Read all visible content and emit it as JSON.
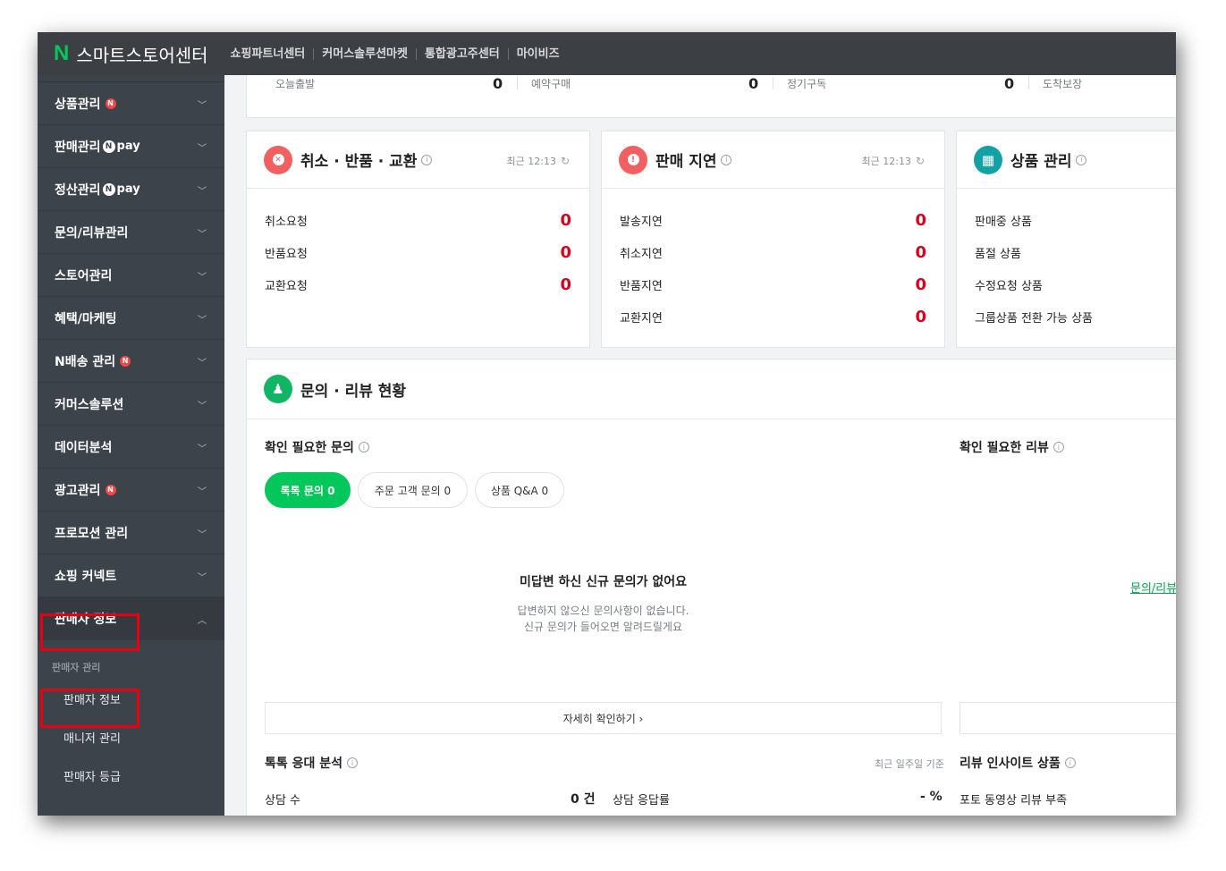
{
  "topbar": {
    "logo": "N",
    "title": "스마트스토어센터",
    "links": [
      "쇼핑파트너센터",
      "커머스솔루션마켓",
      "통합광고주센터",
      "마이비즈"
    ]
  },
  "sidebar": {
    "items": [
      {
        "label": "상품관리",
        "badge": "N",
        "pay": ""
      },
      {
        "label": "판매관리",
        "badge": "",
        "pay": "pay"
      },
      {
        "label": "정산관리",
        "badge": "",
        "pay": "pay"
      },
      {
        "label": "문의/리뷰관리",
        "badge": "",
        "pay": ""
      },
      {
        "label": "스토어관리",
        "badge": "",
        "pay": ""
      },
      {
        "label": "혜택/마케팅",
        "badge": "",
        "pay": ""
      },
      {
        "label": "N배송 관리",
        "badge": "N",
        "pay": ""
      },
      {
        "label": "커머스솔루션",
        "badge": "",
        "pay": ""
      },
      {
        "label": "데이터분석",
        "badge": "",
        "pay": ""
      },
      {
        "label": "광고관리",
        "badge": "N",
        "pay": ""
      },
      {
        "label": "프로모션 관리",
        "badge": "",
        "pay": ""
      },
      {
        "label": "쇼핑 커넥트",
        "badge": "",
        "pay": ""
      },
      {
        "label": "판매자 정보",
        "badge": "",
        "pay": ""
      }
    ],
    "npay_letter": "N",
    "sub_heading": "판매자 관리",
    "sub_items": [
      "판매자 정보",
      "매니저 관리",
      "판매자 등급"
    ]
  },
  "stats": {
    "cells": [
      {
        "label": "오늘출발",
        "value": "0"
      },
      {
        "label": "예약구매",
        "value": "0"
      },
      {
        "label": "정기구독",
        "value": "0"
      },
      {
        "label": "도착보장",
        "value": ""
      }
    ]
  },
  "cancel_card": {
    "title": "취소 · 반품 · 교환",
    "updated": "최근 12:13",
    "rows": [
      {
        "label": "취소요청",
        "value": "0"
      },
      {
        "label": "반품요청",
        "value": "0"
      },
      {
        "label": "교환요청",
        "value": "0"
      }
    ]
  },
  "delay_card": {
    "title": "판매 지연",
    "updated": "최근 12:13",
    "rows": [
      {
        "label": "발송지연",
        "value": "0"
      },
      {
        "label": "취소지연",
        "value": "0"
      },
      {
        "label": "반품지연",
        "value": "0"
      },
      {
        "label": "교환지연",
        "value": "0"
      }
    ]
  },
  "product_card": {
    "title": "상품 관리",
    "rows": [
      {
        "label": "판매중 상품"
      },
      {
        "label": "품절 상품"
      },
      {
        "label": "수정요청 상품"
      },
      {
        "label": "그룹상품 전환 가능 상품"
      }
    ]
  },
  "inquiry_card": {
    "title": "문의 · 리뷰 현황",
    "inquiry_section_title": "확인 필요한 문의",
    "review_section_title": "확인 필요한 리뷰",
    "pills": [
      {
        "label": "톡톡 문의 0",
        "active": true
      },
      {
        "label": "주문 고객 문의 0",
        "active": false
      },
      {
        "label": "상품 Q&A 0",
        "active": false
      }
    ],
    "empty_title": "미답변 하신 신규 문의가 없어요",
    "empty_desc_line1": "답변하지 않으신 문의사항이 없습니다.",
    "empty_desc_line2": "신규 문의가 들어오면 알려드릴게요",
    "review_link": "문의/리뷰",
    "more_button": "자세히 확인하기 ›",
    "talk_analysis_title": "톡톡 응대 분석",
    "talk_analysis_basis": "최근 일주일 기준",
    "consult_count_label": "상담 수",
    "consult_count_value": "0 건",
    "consult_rate_label": "상담 응답률",
    "consult_rate_value": "- %",
    "review_insight_title": "리뷰 인사이트 상품",
    "review_insight_row": "포토 동영상 리뷰 부족"
  },
  "colors": {
    "accent_green": "#03c75a",
    "alert_red": "#d7001e",
    "highlight_red": "#e60012",
    "sidebar_bg": "#3d434b",
    "topbar_bg": "#3c4044"
  }
}
